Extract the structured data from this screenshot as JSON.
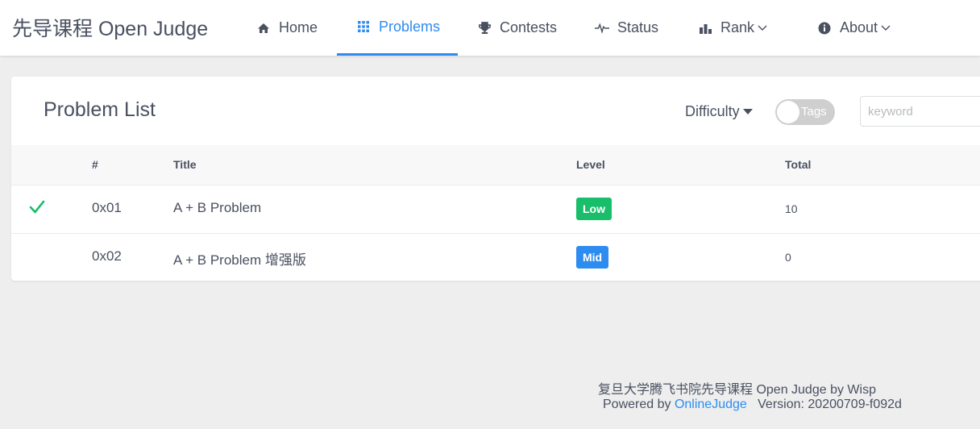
{
  "brand": {
    "title": "先导课程 Open Judge"
  },
  "nav": {
    "home": "Home",
    "problems": "Problems",
    "contests": "Contests",
    "status": "Status",
    "rank": "Rank",
    "about": "About"
  },
  "panel": {
    "title": "Problem List",
    "difficulty": "Difficulty",
    "tags_toggle": "Tags",
    "tags_enabled": false,
    "search_placeholder": "keyword"
  },
  "table": {
    "headers": {
      "id": "#",
      "title": "Title",
      "level": "Level",
      "total": "Total"
    },
    "rows": [
      {
        "solved": true,
        "id": "0x01",
        "title": "A + B Problem",
        "level": "Low",
        "total": "10"
      },
      {
        "solved": false,
        "id": "0x02",
        "title": "A + B Problem 增强版",
        "level": "Mid",
        "total": "0"
      }
    ]
  },
  "footer": {
    "line1": "复旦大学腾飞书院先导课程 Open Judge by Wisp",
    "powered_prefix": "Powered by",
    "powered_link": "OnlineJudge",
    "version": "Version: 20200709-f092d"
  },
  "colors": {
    "accent": "#2d8cf0",
    "low": "#19be6b",
    "mid": "#2d8cf0",
    "check": "#19be6b"
  }
}
